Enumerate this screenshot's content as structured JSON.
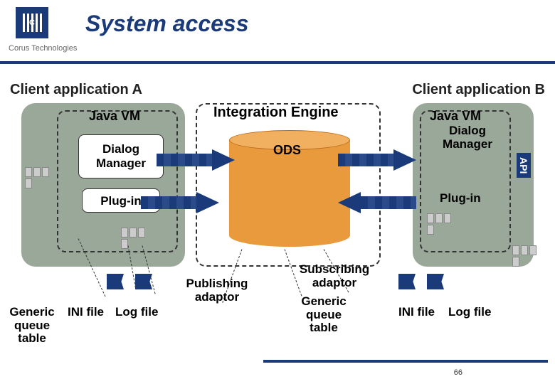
{
  "header": {
    "company": "Corus Technologies",
    "title": "System access"
  },
  "clientA": {
    "title": "Client application A",
    "javaVM": "Java VM",
    "dialogManager": "Dialog Manager",
    "plugin": "Plug-in"
  },
  "clientB": {
    "title": "Client application B",
    "javaVM": "Java VM",
    "dialogManager": "Dialog Manager",
    "plugin": "Plug-in",
    "api": "API"
  },
  "engine": {
    "title": "Integration Engine",
    "ods": "ODS"
  },
  "bottom": {
    "genericQueueTableA": "Generic queue table",
    "iniFileA": "INI file",
    "logFileA": "Log file",
    "publishingAdaptor": "Publishing adaptor",
    "subscribingAdaptor": "Subscribing adaptor",
    "genericQueueTableMid": "Generic queue table",
    "iniFileB": "INI file",
    "logFileB": "Log file"
  },
  "pageNumber": "66"
}
